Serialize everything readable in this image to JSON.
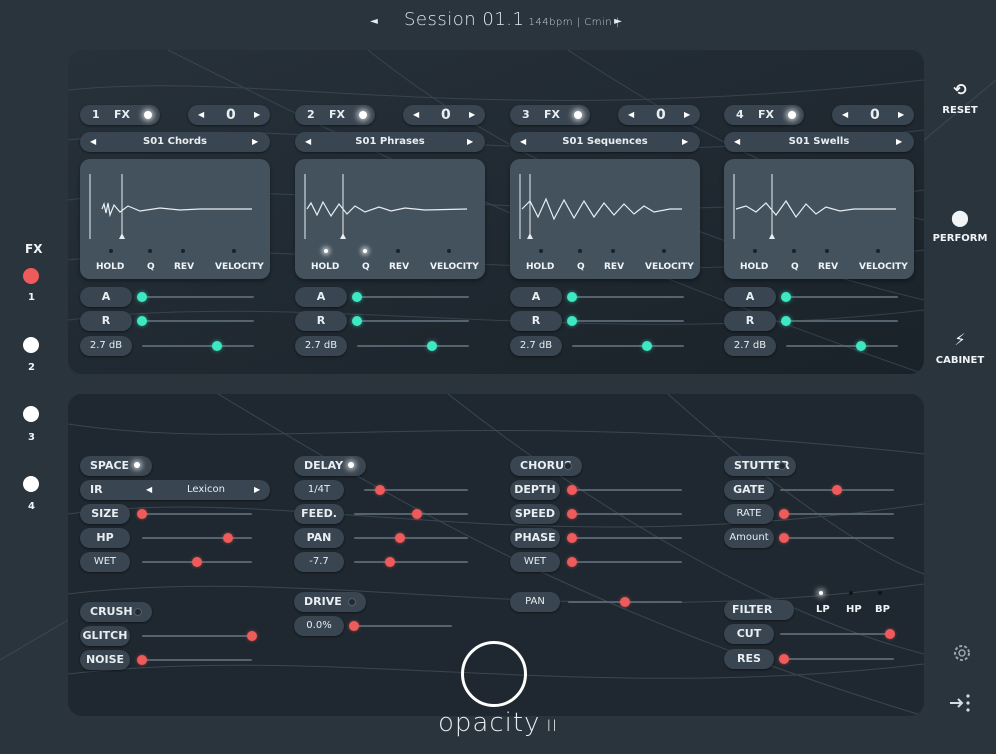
{
  "header": {
    "prev_label": "◄",
    "next_label": "►",
    "session_name": "Session 01.1",
    "session_meta": "144bpm | Cmin |"
  },
  "sidebar_left": {
    "title": "FX",
    "items": [
      {
        "label": "1",
        "active": true
      },
      {
        "label": "2",
        "active": false
      },
      {
        "label": "3",
        "active": false
      },
      {
        "label": "4",
        "active": false
      }
    ]
  },
  "sidebar_right": {
    "reset_label": "RESET",
    "perform_label": "PERFORM",
    "cabinet_label": "CABINET"
  },
  "channels": [
    {
      "num": "1",
      "fx_label": "FX",
      "octave": "0",
      "preset": "S01 Chords",
      "hold_on": false,
      "q_on": false,
      "gain": "2.7 dB",
      "a": 0.0,
      "r": 0.0,
      "g": 0.67
    },
    {
      "num": "2",
      "fx_label": "FX",
      "octave": "0",
      "preset": "S01 Phrases",
      "hold_on": true,
      "q_on": true,
      "gain": "2.7 dB",
      "a": 0.0,
      "r": 0.0,
      "g": 0.67
    },
    {
      "num": "3",
      "fx_label": "FX",
      "octave": "0",
      "preset": "S01 Sequences",
      "hold_on": false,
      "q_on": false,
      "gain": "2.7 dB",
      "a": 0.0,
      "r": 0.0,
      "g": 0.67
    },
    {
      "num": "4",
      "fx_label": "FX",
      "octave": "0",
      "preset": "S01 Swells",
      "hold_on": false,
      "q_on": false,
      "gain": "2.7 dB",
      "a": 0.0,
      "r": 0.0,
      "g": 0.67
    }
  ],
  "wave_labels": {
    "hold": "HOLD",
    "q": "Q",
    "rev": "REV",
    "velocity": "VELOCITY"
  },
  "env_labels": {
    "a": "A",
    "r": "R"
  },
  "fx": {
    "space": {
      "label": "SPACE",
      "on": true
    },
    "ir": {
      "label": "IR",
      "value": "Lexicon"
    },
    "size": {
      "label": "SIZE",
      "value": 0.0
    },
    "hp": {
      "label": "HP",
      "value": 0.78
    },
    "wet": {
      "label": "WET",
      "value": 0.5
    },
    "crush": {
      "label": "CRUSH",
      "on": false
    },
    "glitch": {
      "label": "GLITCH",
      "value": 1.0
    },
    "noise": {
      "label": "NOISE",
      "value": 0.0
    },
    "delay": {
      "label": "DELAY",
      "on": true
    },
    "delay_time": {
      "label": "1/4T",
      "value": 0.15
    },
    "feed": {
      "label": "FEED.",
      "value": 0.55
    },
    "pan": {
      "label": "PAN",
      "value": 0.4
    },
    "pan_val": {
      "label": "-7.7",
      "value": 0.32
    },
    "drive": {
      "label": "DRIVE",
      "on": false
    },
    "drive_amt": {
      "label": "0.0%",
      "value": 0.0
    },
    "chorus": {
      "label": "CHORUS",
      "on": false
    },
    "depth": {
      "label": "DEPTH",
      "value": 0.0
    },
    "speed": {
      "label": "SPEED",
      "value": 0.0
    },
    "phase": {
      "label": "PHASE",
      "value": 0.0
    },
    "chorus_wet": {
      "label": "WET",
      "value": 0.0
    },
    "chorus_pan": {
      "label": "PAN",
      "value": 0.5
    },
    "stutter": {
      "label": "STUTTER",
      "on": false
    },
    "gate": {
      "label": "GATE",
      "value": 0.5
    },
    "rate": {
      "label": "RATE",
      "value": 0.0
    },
    "amount": {
      "label": "Amount",
      "value": 0.0
    },
    "filter": {
      "label": "FILTER",
      "modes": [
        "LP",
        "HP",
        "BP"
      ],
      "selected": "LP"
    },
    "cut": {
      "label": "CUT",
      "value": 1.0
    },
    "res": {
      "label": "RES",
      "value": 0.0
    }
  },
  "logo": {
    "name": "opacity",
    "suffix": "II"
  },
  "colors": {
    "teal": "#3ee8c3",
    "red": "#ef5a5a",
    "active_fx": "#ef5a5a"
  }
}
